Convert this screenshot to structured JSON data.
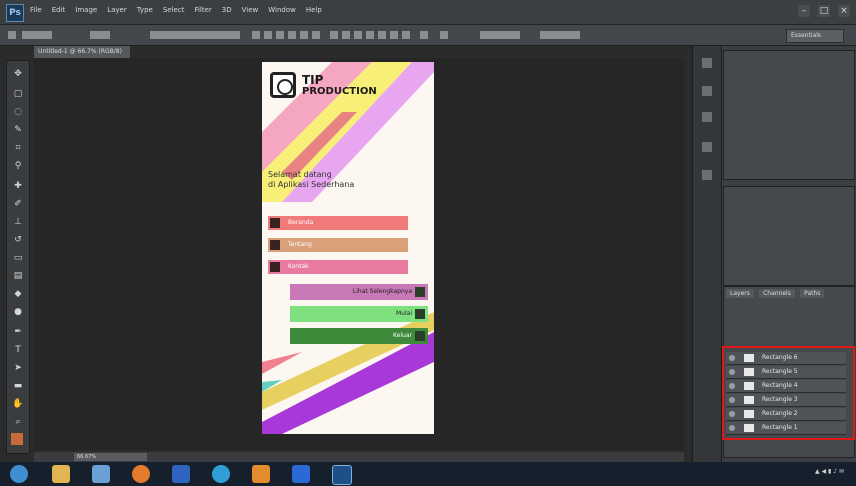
{
  "app": {
    "logo": "Ps",
    "menu": [
      "File",
      "Edit",
      "Image",
      "Layer",
      "Type",
      "Select",
      "Filter",
      "3D",
      "View",
      "Window",
      "Help"
    ],
    "window_controls": [
      "minimize",
      "maximize",
      "close"
    ]
  },
  "options": {
    "chips": [
      "Essentials"
    ]
  },
  "document_tab": "Untitled-1 @ 66.7% (RGB/8)",
  "status_label": "66.67%",
  "doc": {
    "brand_line1": "TIP",
    "brand_line2": "PRODUCTION",
    "subtitle_line1": "Selamat datang",
    "subtitle_line2": "di Aplikasi Sederhana",
    "menu_buttons": [
      {
        "label": "Beranda",
        "color": "#f07a7a"
      },
      {
        "label": "Tentang",
        "color": "#d9a07a"
      },
      {
        "label": "Kontak",
        "color": "#e87aa0"
      }
    ],
    "action_buttons": [
      {
        "label": "Lihat Selengkapnya",
        "color": "#c878b6"
      },
      {
        "label": "Mulai",
        "color": "#7ee07e"
      },
      {
        "label": "Keluar",
        "color": "#3e8a3a"
      }
    ]
  },
  "layers_panel": {
    "tabs": [
      "Layers",
      "Channels",
      "Paths"
    ],
    "layers": [
      "Rectangle 6",
      "Rectangle 5",
      "Rectangle 4",
      "Rectangle 3",
      "Rectangle 2",
      "Rectangle 1"
    ]
  },
  "colors": {
    "highlight": "#e01818",
    "accent": "#9f33c9"
  }
}
